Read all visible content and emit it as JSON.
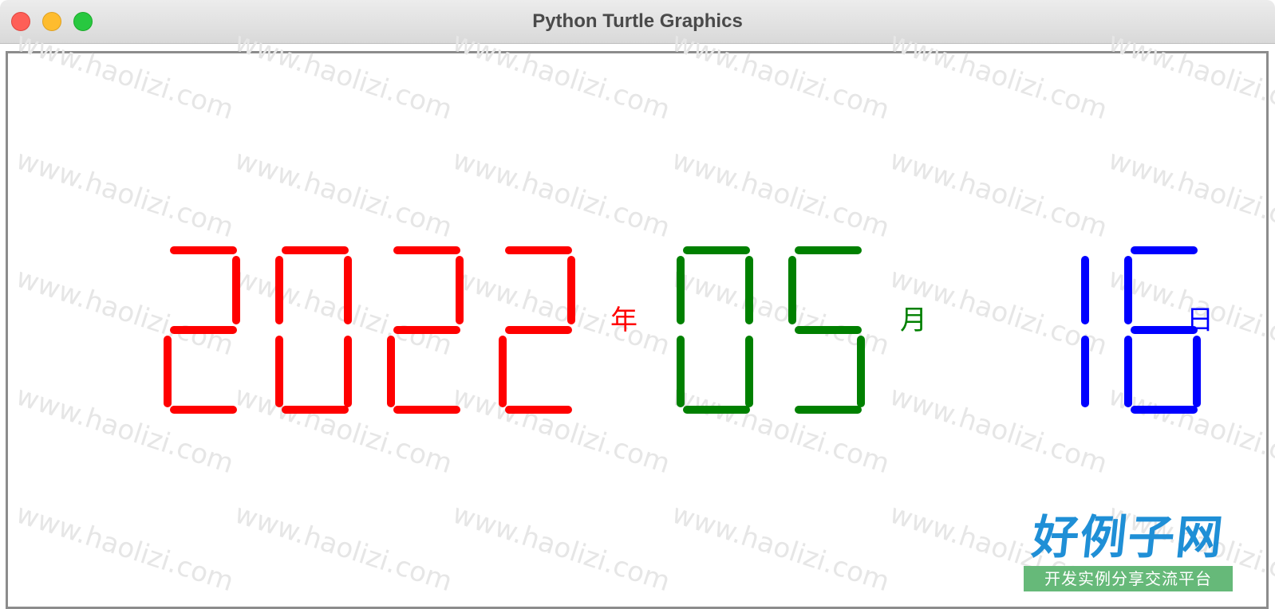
{
  "window": {
    "title": "Python Turtle Graphics"
  },
  "display": {
    "year": {
      "digits": [
        "2",
        "0",
        "2",
        "2"
      ],
      "unit": "年",
      "color": "#ff0000"
    },
    "month": {
      "digits": [
        "0",
        "5"
      ],
      "unit": "月",
      "color": "#008000"
    },
    "day": {
      "digits": [
        "1",
        "6"
      ],
      "unit": "日",
      "color": "#0000ff"
    }
  },
  "watermark": {
    "text": "www.haolizi.com",
    "logo_main": "好例子网",
    "logo_sub": "开发实例分享交流平台"
  }
}
